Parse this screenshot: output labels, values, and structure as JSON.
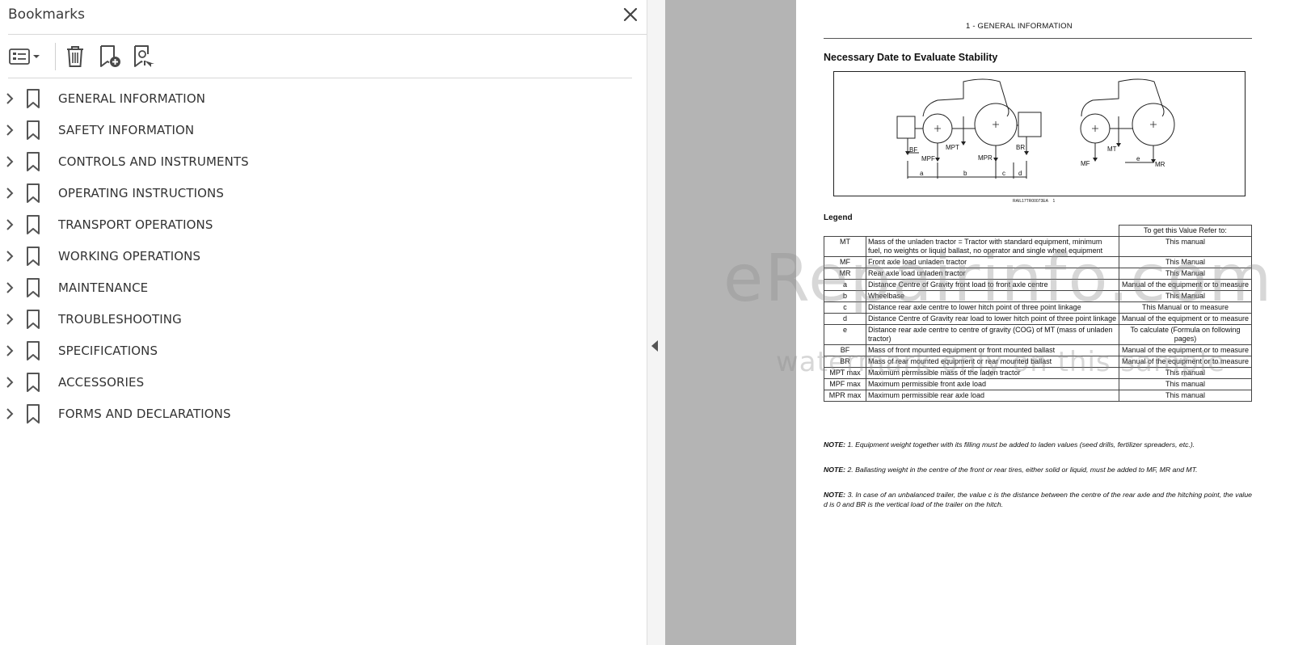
{
  "bookmarks_panel": {
    "title": "Bookmarks",
    "toolbar": {
      "options_icon": "list-options-icon",
      "delete_icon": "trash-icon",
      "new_bookmark_icon": "bookmark-add-icon",
      "find_bookmark_icon": "bookmark-search-icon"
    },
    "items": [
      {
        "label": "GENERAL INFORMATION"
      },
      {
        "label": "SAFETY INFORMATION"
      },
      {
        "label": "CONTROLS AND INSTRUMENTS"
      },
      {
        "label": "OPERATING INSTRUCTIONS"
      },
      {
        "label": "TRANSPORT OPERATIONS"
      },
      {
        "label": "WORKING OPERATIONS"
      },
      {
        "label": "MAINTENANCE"
      },
      {
        "label": "TROUBLESHOOTING"
      },
      {
        "label": "SPECIFICATIONS"
      },
      {
        "label": "ACCESSORIES"
      },
      {
        "label": "FORMS AND DECLARATIONS"
      }
    ]
  },
  "document": {
    "header": "1 - GENERAL INFORMATION",
    "section_title": "Necessary Date to Evaluate Stability",
    "figure": {
      "labels": {
        "bf": "BF",
        "mpf": "MPF",
        "mpt": "MPT",
        "mpr": "MPR",
        "br": "BR",
        "a": "a",
        "b": "b",
        "c": "c",
        "d": "d",
        "mf": "MF",
        "mt": "MT",
        "e": "e",
        "mr": "MR"
      },
      "code": "RAIL17TR00073EA",
      "number": "1"
    },
    "legend_title": "Legend",
    "table_header": "To get this Value Refer to:",
    "rows": [
      {
        "sym": "MT",
        "desc": "Mass of the unladen tractor = Tractor with standard equipment, minimum fuel, no weights or liquid ballast, no operator and single wheel equipment",
        "ref": "This manual"
      },
      {
        "sym": "MF",
        "desc": "Front axle load unladen tractor",
        "ref": "This Manual"
      },
      {
        "sym": "MR",
        "desc": "Rear axle load unladen tractor",
        "ref": "This Manual"
      },
      {
        "sym": "a",
        "desc": "Distance Centre of Gravity front load to front axle centre",
        "ref": "Manual of the equipment or to measure"
      },
      {
        "sym": "b",
        "desc": "Wheelbase",
        "ref": "This Manual"
      },
      {
        "sym": "c",
        "desc": "Distance rear axle centre to lower hitch point of three point linkage",
        "ref": "This Manual or to measure"
      },
      {
        "sym": "d",
        "desc": "Distance Centre of Gravity rear load to lower hitch point of three point linkage",
        "ref": "Manual of the equipment or to measure"
      },
      {
        "sym": "e",
        "desc": "Distance rear axle centre to centre of gravity (COG) of MT (mass of unladen tractor)",
        "ref": "To calculate (Formula on following pages)"
      },
      {
        "sym": "BF",
        "desc": "Mass of front mounted equipment or front mounted ballast",
        "ref": "Manual of the equipment or to measure"
      },
      {
        "sym": "BR",
        "desc": "Mass of rear mounted equipment or rear mounted ballast",
        "ref": "Manual of the equipment or to measure"
      },
      {
        "sym": "MPT max",
        "desc": "Maximum permissible mass of the laden tractor",
        "ref": "This manual"
      },
      {
        "sym": "MPF max",
        "desc": "Maximum permissible front axle load",
        "ref": "This manual"
      },
      {
        "sym": "MPR max",
        "desc": "Maximum permissible rear axle load",
        "ref": "This manual"
      }
    ],
    "notes": [
      {
        "prefix": "NOTE:",
        "text": "1.  Equipment weight together with its filling must be added to laden values (seed drills, fertilizer spreaders, etc.)."
      },
      {
        "prefix": "NOTE:",
        "text": "2.  Ballasting weight in the centre of the front or rear tires, either solid or liquid, must be added to MF, MR and MT."
      },
      {
        "prefix": "NOTE:",
        "text": "3.  In case of an unbalanced trailer, the value c is the distance between the centre of the rear axle and the hitching point, the value d is 0 and BR is the vertical load of the trailer on the hitch."
      }
    ]
  },
  "watermark": {
    "line1": "eRepairinfo.com",
    "line2": "watermark only on this sample"
  },
  "colors": {
    "panel_bg": "#ffffff",
    "doc_bg": "#b4b4b4",
    "text": "#333333",
    "icon": "#4a4a4a"
  }
}
